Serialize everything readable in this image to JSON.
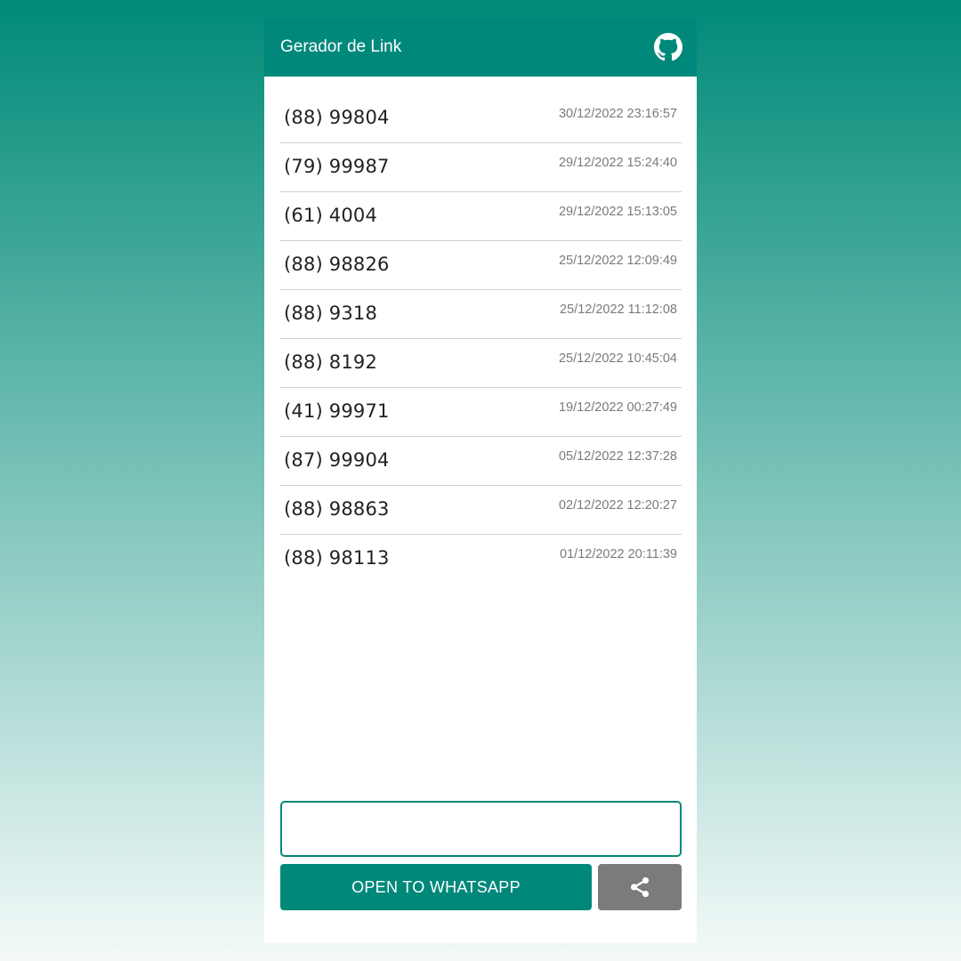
{
  "appbar": {
    "title": "Gerador de Link",
    "action_icon": "github-icon"
  },
  "history": [
    {
      "phone": "(88) 99804",
      "date": "30/12/2022 23:16:57"
    },
    {
      "phone": "(79) 99987",
      "date": "29/12/2022 15:24:40"
    },
    {
      "phone": "(61) 4004",
      "date": "29/12/2022 15:13:05"
    },
    {
      "phone": "(88) 98826",
      "date": "25/12/2022 12:09:49"
    },
    {
      "phone": "(88) 9318",
      "date": "25/12/2022 11:12:08"
    },
    {
      "phone": "(88) 8192",
      "date": "25/12/2022 10:45:04"
    },
    {
      "phone": "(41) 99971",
      "date": "19/12/2022 00:27:49"
    },
    {
      "phone": "(87) 99904",
      "date": "05/12/2022 12:37:28"
    },
    {
      "phone": "(88) 98863",
      "date": "02/12/2022 12:20:27"
    },
    {
      "phone": "(88) 98113",
      "date": "01/12/2022 20:11:39"
    }
  ],
  "input": {
    "value": "",
    "placeholder": ""
  },
  "actions": {
    "open_label": "OPEN TO WHATSAPP",
    "share_icon": "share-icon"
  },
  "colors": {
    "primary": "#00897b",
    "share_button": "#7b7b7b",
    "timestamp": "#7a7a7a"
  }
}
